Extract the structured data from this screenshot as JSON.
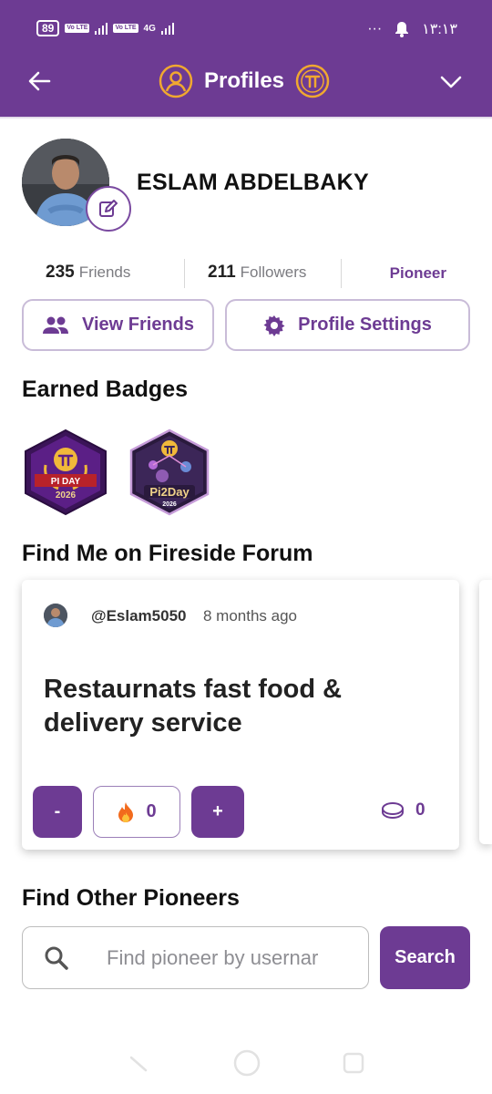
{
  "status_bar": {
    "battery": "89",
    "volte1": "Vo LTE",
    "volte2": "Vo LTE",
    "network": "4G",
    "dots": "···",
    "time": "١٣:١٣"
  },
  "header": {
    "title": "Profiles"
  },
  "profile": {
    "name": "ESLAM ABDELBAKY",
    "friends_count": "235",
    "friends_label": "Friends",
    "followers_count": "211",
    "followers_label": "Followers",
    "role": "Pioneer"
  },
  "actions": {
    "view_friends": "View Friends",
    "profile_settings": "Profile Settings"
  },
  "badges": {
    "title": "Earned Badges",
    "items": [
      {
        "line1": "PI DAY",
        "line2": "2026"
      },
      {
        "line1": "Pi2Day",
        "line2": "2026"
      }
    ]
  },
  "forum": {
    "title": "Find Me on Fireside Forum",
    "post": {
      "handle": "@Eslam5050",
      "time_ago": "8 months ago",
      "title": "Restaurnats fast food & delivery service",
      "minus_label": "-",
      "fire_count": "0",
      "plus_label": "+",
      "coin_count": "0"
    }
  },
  "find": {
    "title": "Find Other Pioneers",
    "placeholder": "Find pioneer by usernar",
    "button": "Search"
  },
  "colors": {
    "brand_purple": "#6d3b93",
    "border_lilac": "#c9bcd8"
  }
}
